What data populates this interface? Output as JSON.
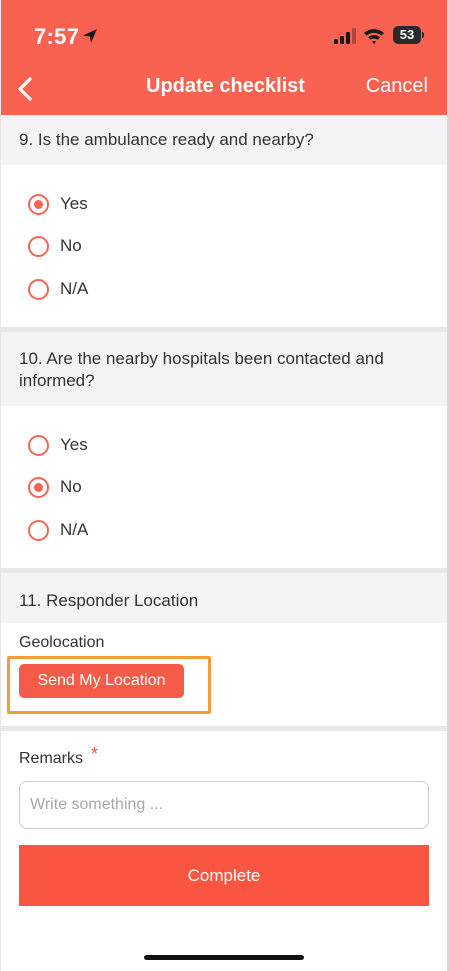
{
  "status_bar": {
    "time": "7:57",
    "battery": "53"
  },
  "nav": {
    "title": "Update checklist",
    "cancel_label": "Cancel"
  },
  "questions": [
    {
      "title": "9. Is the ambulance ready and nearby?",
      "options": [
        "Yes",
        "No",
        "N/A"
      ],
      "selected": "Yes"
    },
    {
      "title": "10. Are the nearby hospitals been contacted and informed?",
      "options": [
        "Yes",
        "No",
        "N/A"
      ],
      "selected": "No"
    },
    {
      "title": "11. Responder Location",
      "field_label": "Geolocation",
      "button_label": "Send My Location"
    }
  ],
  "remarks": {
    "label": "Remarks",
    "required_mark": "*",
    "placeholder": "Write something ..."
  },
  "complete_label": "Complete",
  "colors": {
    "accent": "#f96151",
    "highlight": "#f0a030"
  }
}
